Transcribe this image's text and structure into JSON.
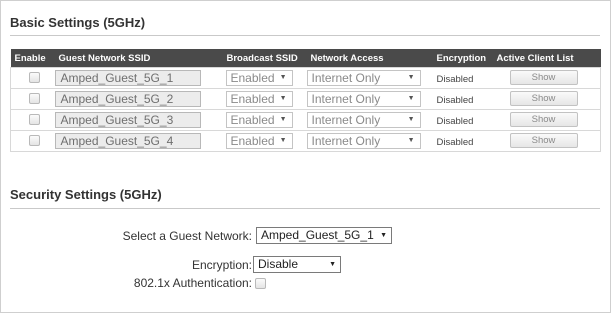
{
  "basic_settings": {
    "title": "Basic Settings (5GHz)",
    "columns": [
      "Enable",
      "Guest Network SSID",
      "Broadcast SSID",
      "Network Access",
      "Encryption",
      "Active Client List"
    ],
    "rows": [
      {
        "enabled": false,
        "ssid": "Amped_Guest_5G_1",
        "broadcast": "Enabled",
        "access": "Internet Only",
        "encryption": "Disabled",
        "client_button": "Show"
      },
      {
        "enabled": false,
        "ssid": "Amped_Guest_5G_2",
        "broadcast": "Enabled",
        "access": "Internet Only",
        "encryption": "Disabled",
        "client_button": "Show"
      },
      {
        "enabled": false,
        "ssid": "Amped_Guest_5G_3",
        "broadcast": "Enabled",
        "access": "Internet Only",
        "encryption": "Disabled",
        "client_button": "Show"
      },
      {
        "enabled": false,
        "ssid": "Amped_Guest_5G_4",
        "broadcast": "Enabled",
        "access": "Internet Only",
        "encryption": "Disabled",
        "client_button": "Show"
      }
    ]
  },
  "security_settings": {
    "title": "Security Settings (5GHz)",
    "guest_network_label": "Select a Guest Network:",
    "guest_network_value": "Amped_Guest_5G_1",
    "encryption_label": "Encryption:",
    "encryption_value": "Disable",
    "auth_label": "802.1x Authentication:",
    "auth_checked": false
  },
  "icons": {
    "dropdown": "chevron-down-icon"
  },
  "colors": {
    "table_header_bg": "#4a4a4a",
    "table_header_text": "#ffffff",
    "rule": "#c9c9c9"
  }
}
